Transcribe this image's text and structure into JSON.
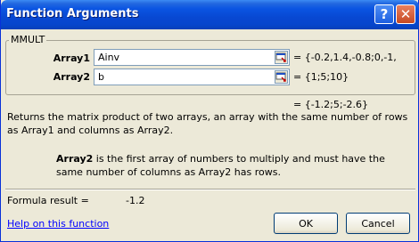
{
  "window": {
    "title": "Function Arguments",
    "help_button": "?",
    "close_button": "✕"
  },
  "function_group": {
    "name": "MMULT",
    "args": [
      {
        "label": "Array1",
        "value": "Ainv",
        "result": "= {-0.2,1.4,-0.8;0,-1,"
      },
      {
        "label": "Array2",
        "value": "b",
        "result": "= {1;5;10}"
      }
    ],
    "final_result": "= {-1.2;5;-2.6}"
  },
  "description": "Returns the matrix product of two arrays, an array with the same number of rows as Array1 and columns as Array2.",
  "arg_help": {
    "name": "Array2",
    "text": " is the first array of numbers to multiply and must have the same number of columns as Array2 has rows."
  },
  "formula": {
    "label": "Formula result =",
    "value": "-1.2"
  },
  "help_link": "Help on this function",
  "buttons": {
    "ok": "OK",
    "cancel": "Cancel"
  },
  "icons": {
    "collapse": "collapse-dialog-icon"
  }
}
